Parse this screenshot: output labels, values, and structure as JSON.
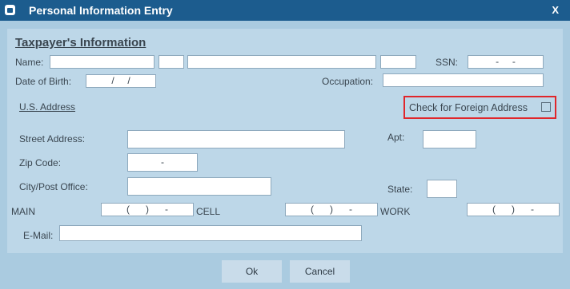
{
  "window": {
    "title": "Personal Information Entry",
    "close_label": "X"
  },
  "section": {
    "title": "Taxpayer's Information"
  },
  "name": {
    "label": "Name:"
  },
  "ssn": {
    "label": "SSN:",
    "value": "-     -"
  },
  "dob": {
    "label": "Date of Birth:",
    "value": "/     /"
  },
  "occupation": {
    "label": "Occupation:"
  },
  "us_address": {
    "label": "U.S. Address"
  },
  "foreign": {
    "label": "Check for Foreign Address",
    "checked": false
  },
  "street": {
    "label": "Street Address:"
  },
  "apt": {
    "label": "Apt:"
  },
  "zip": {
    "label": "Zip Code:",
    "value": "-"
  },
  "city": {
    "label": "City/Post Office:"
  },
  "state": {
    "label": "State:"
  },
  "phones": {
    "main_label": "MAIN",
    "main_value": "(      )      -",
    "cell_label": "CELL",
    "cell_value": "(      )      -",
    "work_label": "WORK",
    "work_value": "(      )      -"
  },
  "email": {
    "label": "E-Mail:"
  },
  "buttons": {
    "ok": "Ok",
    "cancel": "Cancel"
  }
}
